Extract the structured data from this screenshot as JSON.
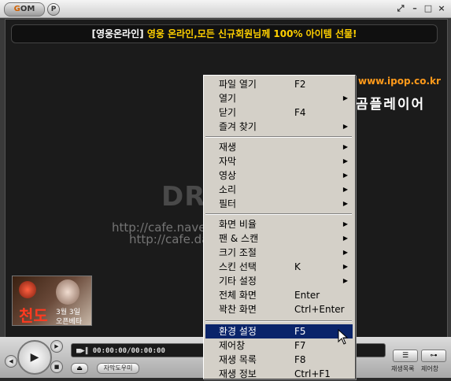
{
  "titlebar": {
    "logo_g": "G",
    "logo_rest": "OM",
    "p_label": "P",
    "controls": [
      "⤢",
      "–",
      "□",
      "×"
    ]
  },
  "banner": {
    "part1": "[영웅온라인]",
    "part2": "영웅 온라인,모든 신규회원님께 100% 아이템 선물!"
  },
  "overlay": {
    "site": "www.ipop.co.kr",
    "player_name": "곰플레이어",
    "watermark": "DREAMOFIT",
    "url1": "http://cafe.naver.com/dreamofit.cafe",
    "url2": "http://cafe.daum.net/dreamofit"
  },
  "ad": {
    "title": "천도",
    "date": "3월 3일",
    "sub": "오픈베타"
  },
  "lcd": {
    "text": "■▶∥ 00:00:00/00:00:00"
  },
  "bottom": {
    "eject": "⏏",
    "subtitle_tool": "자막도우미",
    "playlist_label": "재생목록",
    "equalizer_label": "제어창"
  },
  "context_menu": {
    "items": [
      {
        "label": "파일 열기",
        "shortcut": "F2",
        "arrow": ""
      },
      {
        "label": "열기",
        "shortcut": "",
        "arrow": "▶"
      },
      {
        "label": "닫기",
        "shortcut": "F4",
        "arrow": ""
      },
      {
        "label": "즐겨 찾기",
        "shortcut": "",
        "arrow": "▶"
      },
      {
        "label": "재생",
        "shortcut": "",
        "arrow": "▶"
      },
      {
        "label": "자막",
        "shortcut": "",
        "arrow": "▶"
      },
      {
        "label": "영상",
        "shortcut": "",
        "arrow": "▶"
      },
      {
        "label": "소리",
        "shortcut": "",
        "arrow": "▶"
      },
      {
        "label": "필터",
        "shortcut": "",
        "arrow": "▶"
      },
      {
        "label": "화면 비율",
        "shortcut": "",
        "arrow": "▶"
      },
      {
        "label": "팬 & 스캔",
        "shortcut": "",
        "arrow": "▶"
      },
      {
        "label": "크기 조절",
        "shortcut": "",
        "arrow": "▶"
      },
      {
        "label": "스킨 선택",
        "shortcut": "K",
        "arrow": "▶"
      },
      {
        "label": "기타 설정",
        "shortcut": "",
        "arrow": "▶"
      },
      {
        "label": "전체 화면",
        "shortcut": "Enter",
        "arrow": ""
      },
      {
        "label": "꽉찬 화면",
        "shortcut": "Ctrl+Enter",
        "arrow": ""
      },
      {
        "label": "환경 설정",
        "shortcut": "F5",
        "arrow": ""
      },
      {
        "label": "제어창",
        "shortcut": "F7",
        "arrow": ""
      },
      {
        "label": "재생 목록",
        "shortcut": "F8",
        "arrow": ""
      },
      {
        "label": "재생 정보",
        "shortcut": "Ctrl+F1",
        "arrow": ""
      }
    ],
    "highlighted_index": 16
  },
  "colors": {
    "highlight": "#0a246a",
    "banner_text": "#ffd000",
    "site_text": "#ff9a1a"
  }
}
